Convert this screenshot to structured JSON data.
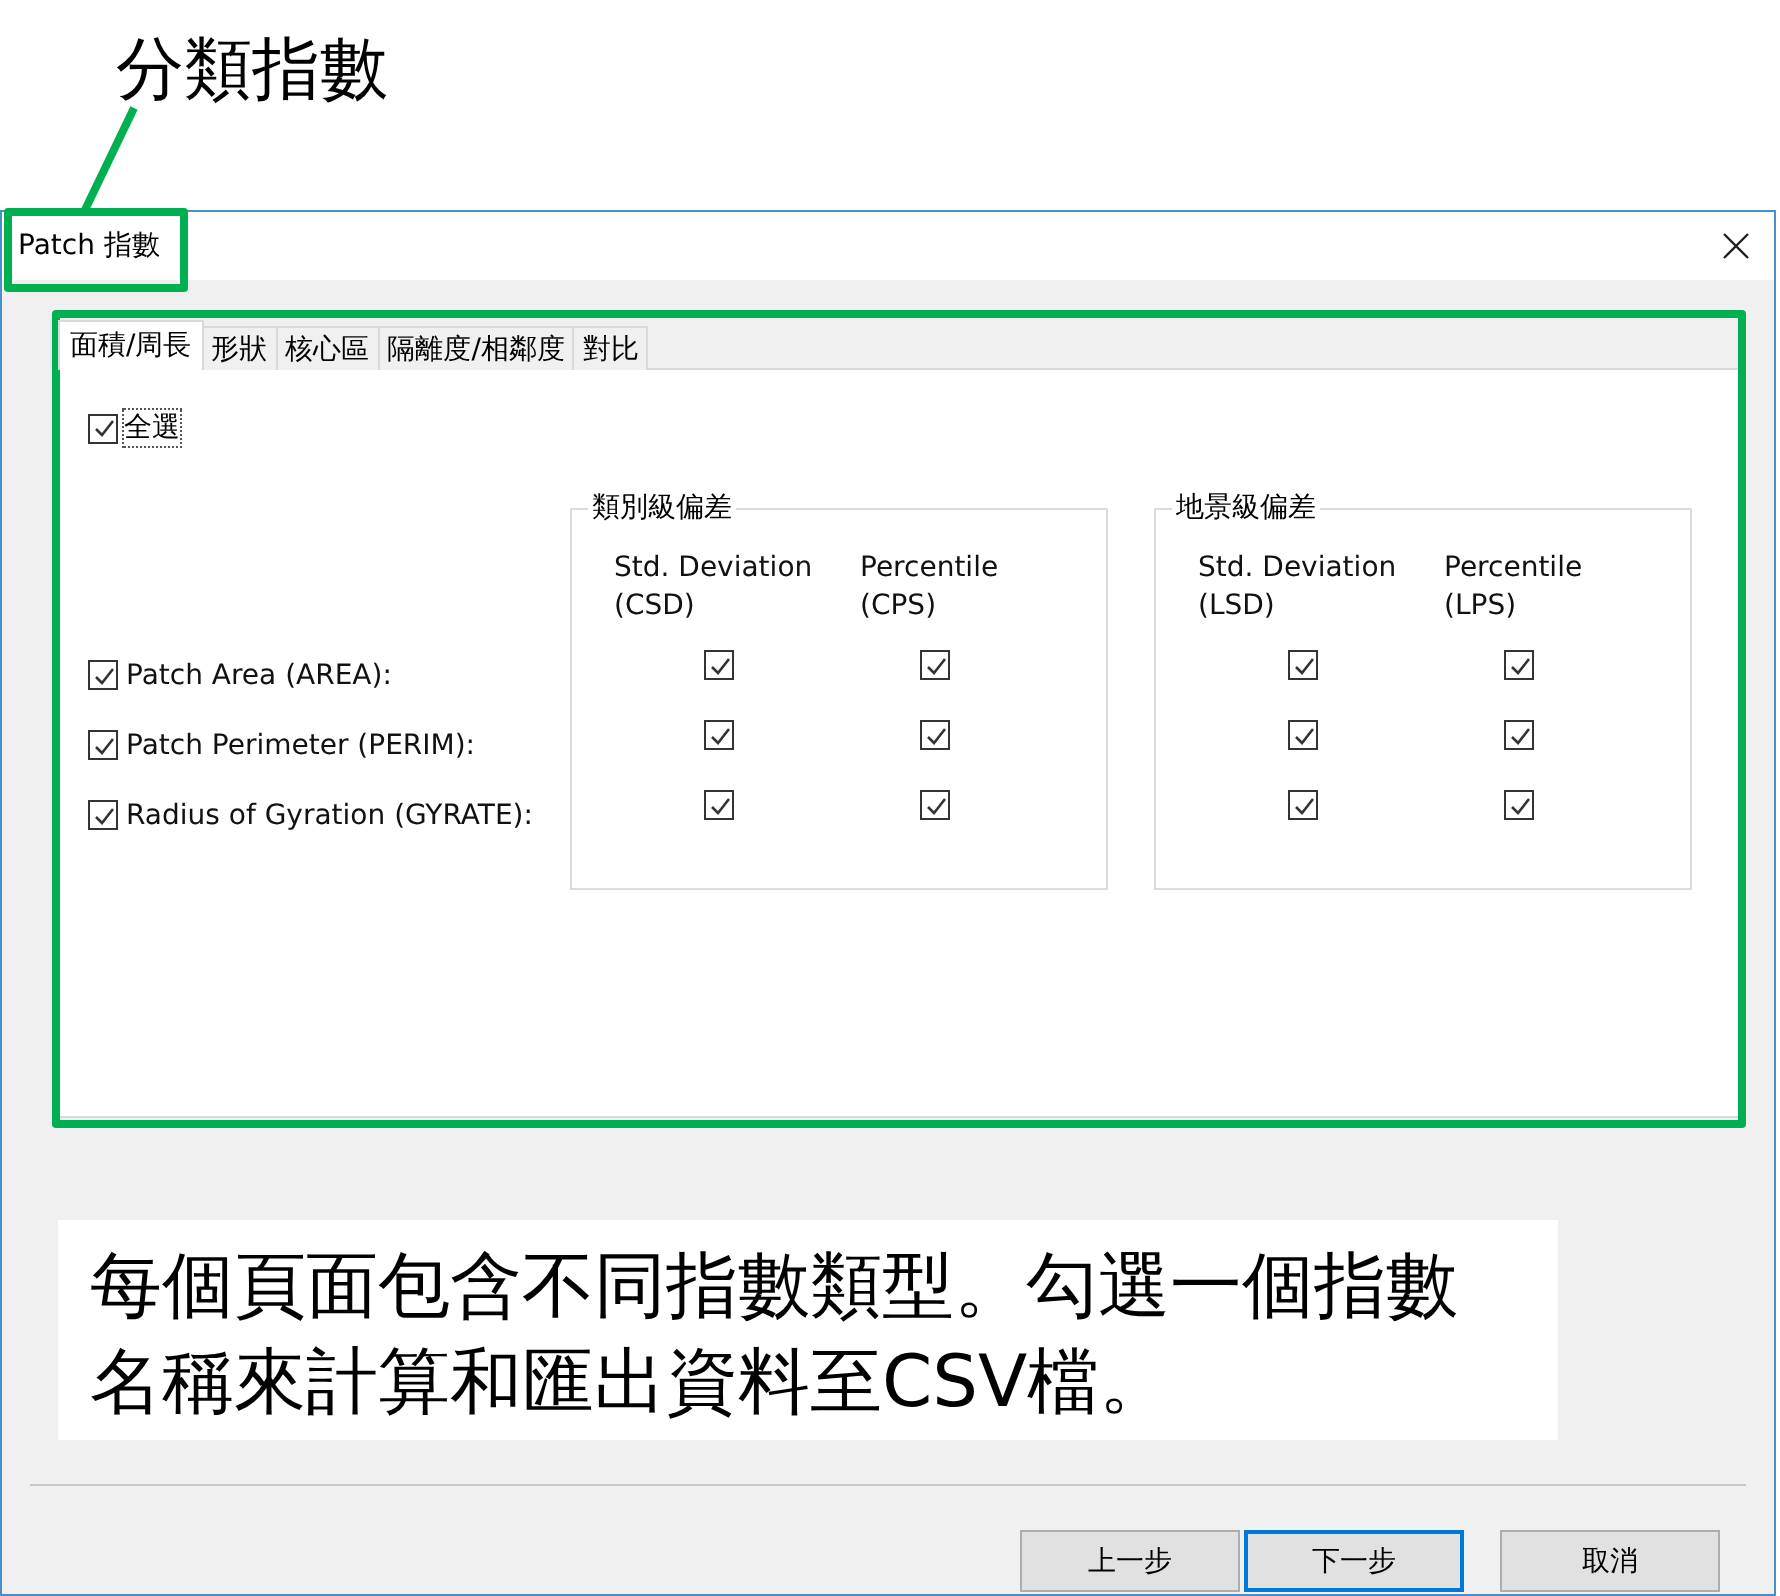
{
  "annotation": {
    "title": "分類指數",
    "note": "每個頁面包含不同指數類型。勾選一個指數名稱來計算和匯出資料至CSV檔。"
  },
  "window": {
    "title": "Patch 指數"
  },
  "tabs": [
    {
      "label": "面積/周長",
      "selected": true
    },
    {
      "label": "形狀",
      "selected": false
    },
    {
      "label": "核心區",
      "selected": false
    },
    {
      "label": "隔離度/相鄰度",
      "selected": false
    },
    {
      "label": "對比",
      "selected": false
    }
  ],
  "select_all": {
    "label": "全選",
    "checked": true
  },
  "groups": [
    {
      "title": "類別級偏差",
      "columns": [
        "Std. Deviation\n(CSD)",
        "Percentile\n(CPS)"
      ]
    },
    {
      "title": "地景級偏差",
      "columns": [
        "Std. Deviation\n(LSD)",
        "Percentile\n(LPS)"
      ]
    }
  ],
  "metrics": [
    {
      "label": "Patch Area (AREA):",
      "checked": true,
      "values": [
        true,
        true,
        true,
        true
      ]
    },
    {
      "label": "Patch Perimeter (PERIM):",
      "checked": true,
      "values": [
        true,
        true,
        true,
        true
      ]
    },
    {
      "label": "Radius of Gyration (GYRATE):",
      "checked": true,
      "values": [
        true,
        true,
        true,
        true
      ]
    }
  ],
  "buttons": [
    {
      "label": "上一步",
      "focused": false
    },
    {
      "label": "下一步",
      "focused": true
    },
    {
      "label": "取消",
      "focused": false
    }
  ]
}
